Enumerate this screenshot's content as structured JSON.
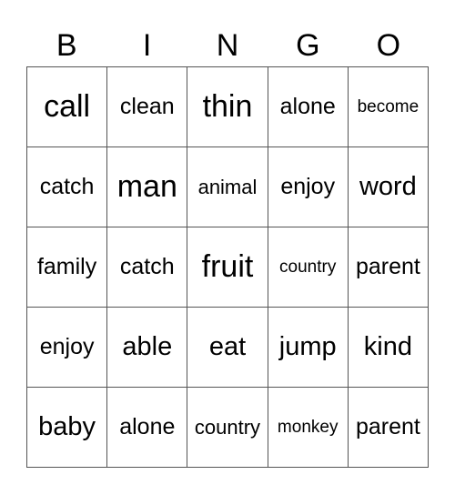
{
  "header": [
    "B",
    "I",
    "N",
    "G",
    "O"
  ],
  "rows": [
    [
      "call",
      "clean",
      "thin",
      "alone",
      "become"
    ],
    [
      "catch",
      "man",
      "animal",
      "enjoy",
      "word"
    ],
    [
      "family",
      "catch",
      "fruit",
      "country",
      "parent"
    ],
    [
      "enjoy",
      "able",
      "eat",
      "jump",
      "kind"
    ],
    [
      "baby",
      "alone",
      "country",
      "monkey",
      "parent"
    ]
  ]
}
